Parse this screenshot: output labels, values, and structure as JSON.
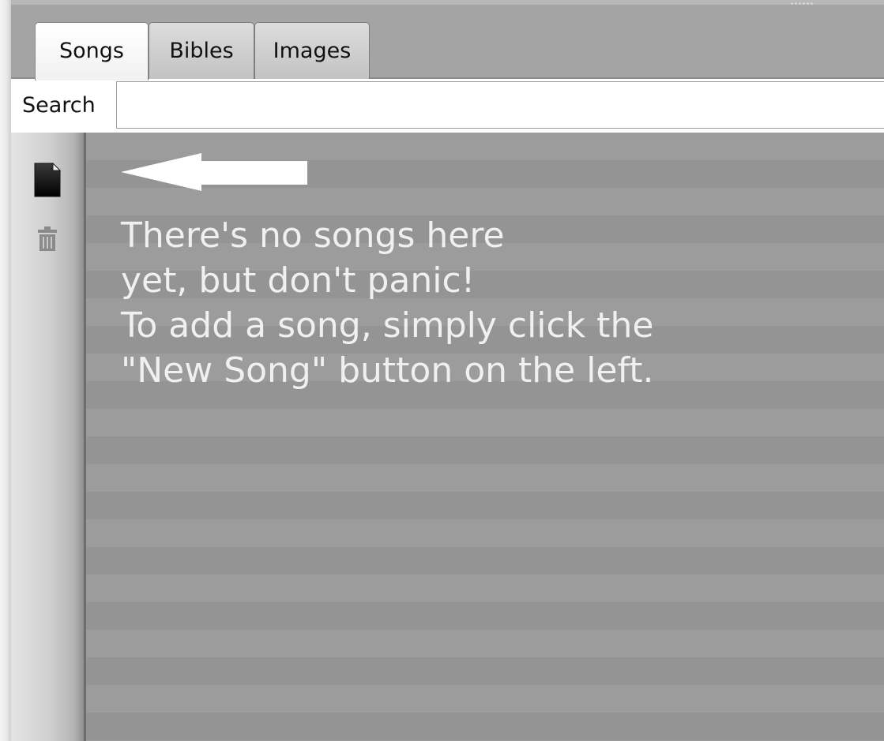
{
  "tabs": [
    {
      "label": "Songs",
      "active": true
    },
    {
      "label": "Bibles",
      "active": false
    },
    {
      "label": "Images",
      "active": false
    }
  ],
  "search": {
    "label": "Search",
    "value": "",
    "placeholder": ""
  },
  "toolbar": {
    "new_song_icon": "new-document-icon",
    "delete_icon": "trash-icon"
  },
  "empty_state": {
    "arrow_icon": "arrow-left-icon",
    "lines": [
      "There's no songs here",
      "yet, but don't panic!",
      "To add a song, simply click the",
      "\"New Song\" button on the left."
    ]
  },
  "colors": {
    "panel_background": "#9c9c9c",
    "message_text": "#f0f0f0",
    "arrow": "#ffffff"
  }
}
